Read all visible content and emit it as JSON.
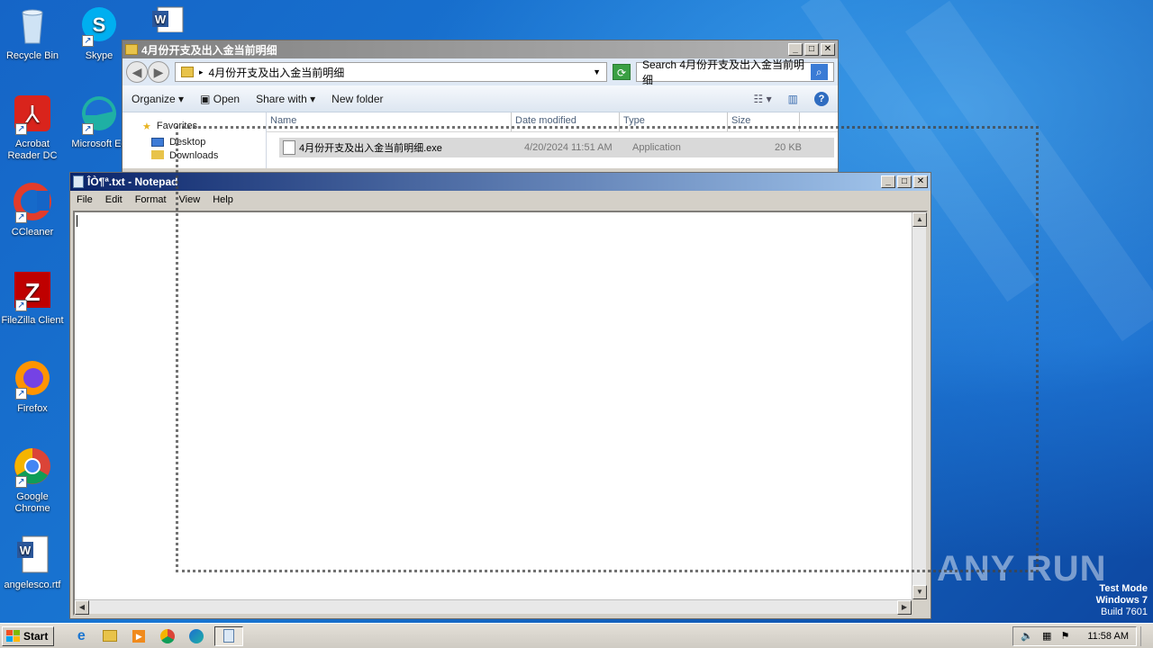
{
  "desktop": {
    "icons": [
      {
        "label": "Recycle Bin",
        "icon": "recycle-bin-icon"
      },
      {
        "label": "Skype",
        "icon": "skype-icon"
      },
      {
        "label": "",
        "icon": "word-doc-icon"
      },
      {
        "label": "Acrobat Reader DC",
        "icon": "acrobat-icon"
      },
      {
        "label": "Microsoft Ed",
        "icon": "edge-icon"
      },
      {
        "label": "CCleaner",
        "icon": "ccleaner-icon"
      },
      {
        "label": "FileZilla Client",
        "icon": "filezilla-icon"
      },
      {
        "label": "Firefox",
        "icon": "firefox-icon"
      },
      {
        "label": "Google Chrome",
        "icon": "chrome-icon"
      },
      {
        "label": "angelesco.rtf",
        "icon": "rtf-doc-icon"
      }
    ]
  },
  "explorer": {
    "title": "4月份开支及出入金当前明细",
    "address": "4月份开支及出入金当前明细",
    "search_placeholder": "Search 4月份开支及出入金当前明细",
    "commands": {
      "organize": "Organize",
      "open": "Open",
      "share_with": "Share with",
      "new_folder": "New folder"
    },
    "nav": {
      "favorites": "Favorites",
      "desktop": "Desktop",
      "downloads": "Downloads"
    },
    "columns": {
      "name": "Name",
      "date": "Date modified",
      "type": "Type",
      "size": "Size"
    },
    "file": {
      "name": "4月份开支及出入金当前明细.exe",
      "date": "4/20/2024 11:51 AM",
      "type": "Application",
      "size": "20 KB"
    }
  },
  "notepad": {
    "title": "ÎÒ¶ª.txt - Notepad",
    "menu": {
      "file": "File",
      "edit": "Edit",
      "format": "Format",
      "view": "View",
      "help": "Help"
    },
    "content": ""
  },
  "taskbar": {
    "start": "Start",
    "clock": "11:58 AM"
  },
  "watermark": {
    "brand": "ANY RUN",
    "mode": "Test Mode",
    "os": "Windows 7",
    "build": "Build 7601"
  },
  "colors": {
    "desktop": "#1976d2",
    "notepad_title": "#0a246a",
    "explorer_title": "#808080"
  }
}
